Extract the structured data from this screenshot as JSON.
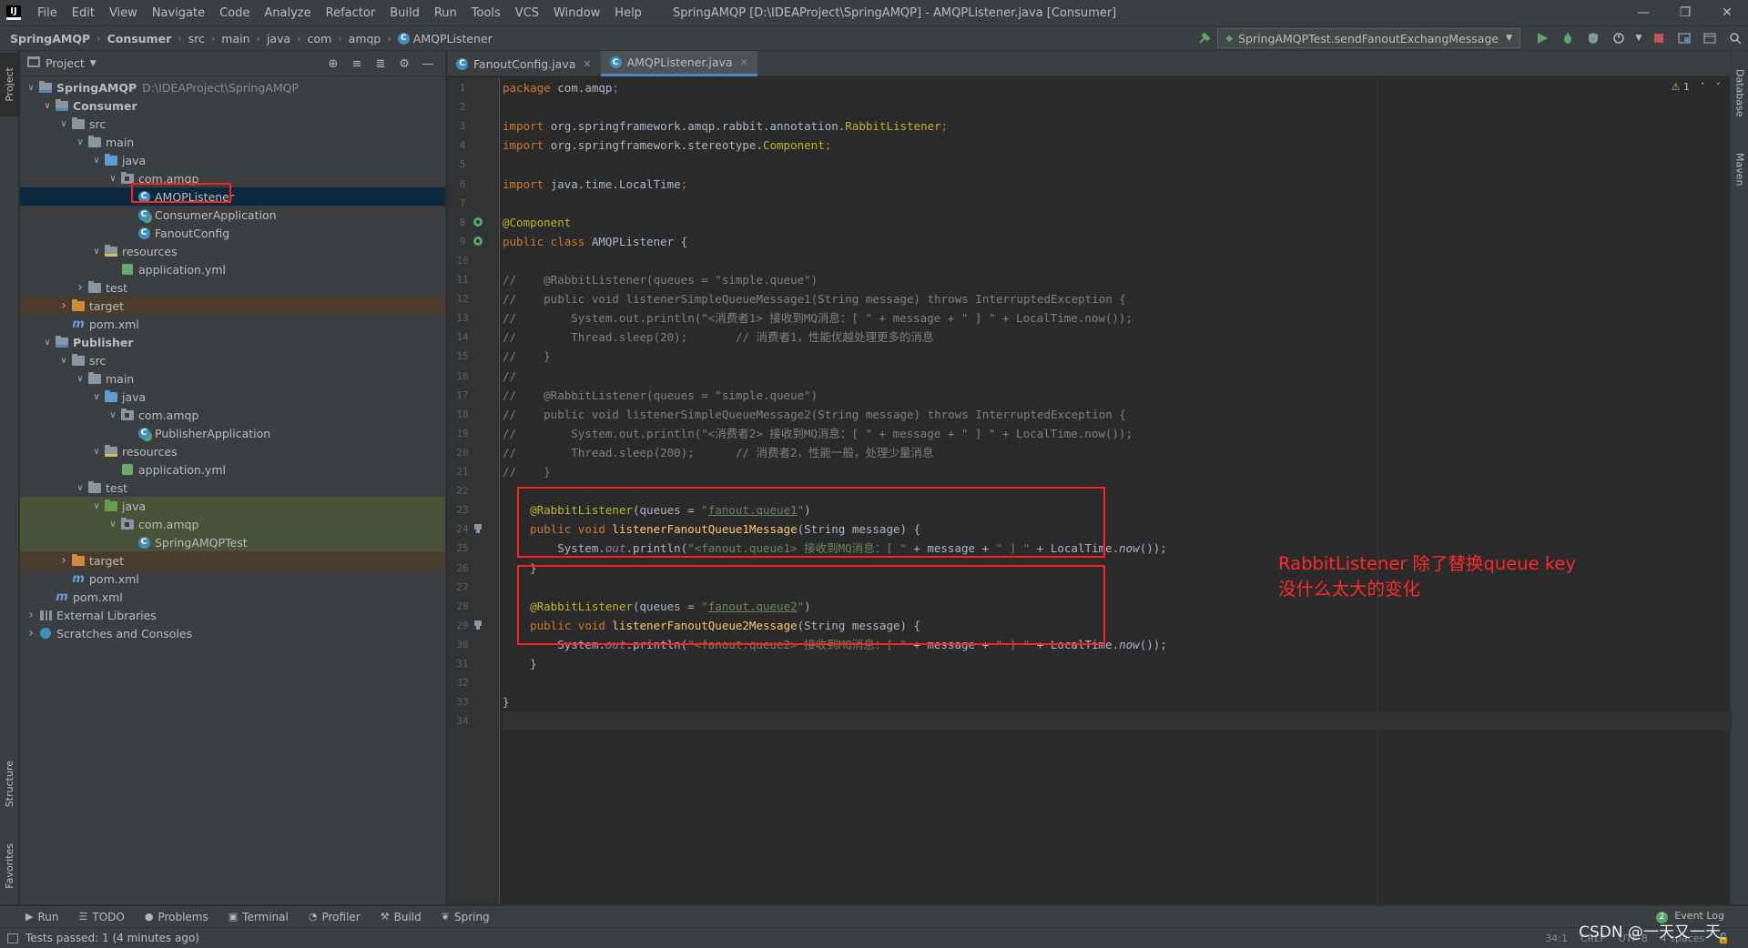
{
  "menubar": {
    "items": [
      "File",
      "Edit",
      "View",
      "Navigate",
      "Code",
      "Analyze",
      "Refactor",
      "Build",
      "Run",
      "Tools",
      "VCS",
      "Window",
      "Help"
    ],
    "title": "SpringAMQP [D:\\IDEAProject\\SpringAMQP] - AMQPListener.java [Consumer]"
  },
  "breadcrumb": [
    "SpringAMQP",
    "Consumer",
    "src",
    "main",
    "java",
    "com",
    "amqp",
    "AMQPListener"
  ],
  "run_config": "SpringAMQPTest.sendFanoutExchangMessage",
  "left_tabs": {
    "project": "Project",
    "structure": "Structure",
    "favorites": "Favorites"
  },
  "right_tabs": {
    "database": "Database",
    "maven": "Maven"
  },
  "project_panel": {
    "title": "Project"
  },
  "tree": [
    {
      "label": "SpringAMQP",
      "path": "D:\\IDEAProject\\SpringAMQP",
      "depth": 0,
      "arrow": "down",
      "icon": "module-folder-icon",
      "bold": true
    },
    {
      "label": "Consumer",
      "depth": 1,
      "arrow": "down",
      "icon": "module-folder-icon",
      "bold": true
    },
    {
      "label": "src",
      "depth": 2,
      "arrow": "down",
      "icon": "folder-icon"
    },
    {
      "label": "main",
      "depth": 3,
      "arrow": "down",
      "icon": "folder-icon"
    },
    {
      "label": "java",
      "depth": 4,
      "arrow": "down",
      "icon": "source-folder-icon"
    },
    {
      "label": "com.amqp",
      "depth": 5,
      "arrow": "down",
      "icon": "package-icon"
    },
    {
      "label": "AMQPListener",
      "depth": 6,
      "arrow": "",
      "icon": "class-icon",
      "state": "selected"
    },
    {
      "label": "ConsumerApplication",
      "depth": 6,
      "arrow": "",
      "icon": "spring-class-icon"
    },
    {
      "label": "FanoutConfig",
      "depth": 6,
      "arrow": "",
      "icon": "class-icon"
    },
    {
      "label": "resources",
      "depth": 4,
      "arrow": "down",
      "icon": "resources-folder-icon"
    },
    {
      "label": "application.yml",
      "depth": 5,
      "arrow": "",
      "icon": "yml-file-icon"
    },
    {
      "label": "test",
      "depth": 3,
      "arrow": "right",
      "icon": "folder-icon"
    },
    {
      "label": "target",
      "depth": 2,
      "arrow": "right",
      "icon": "target-folder-icon",
      "state": "excluded"
    },
    {
      "label": "pom.xml",
      "depth": 2,
      "arrow": "",
      "icon": "maven-icon"
    },
    {
      "label": "Publisher",
      "depth": 1,
      "arrow": "down",
      "icon": "module-folder-icon",
      "bold": true
    },
    {
      "label": "src",
      "depth": 2,
      "arrow": "down",
      "icon": "folder-icon"
    },
    {
      "label": "main",
      "depth": 3,
      "arrow": "down",
      "icon": "folder-icon"
    },
    {
      "label": "java",
      "depth": 4,
      "arrow": "down",
      "icon": "source-folder-icon"
    },
    {
      "label": "com.amqp",
      "depth": 5,
      "arrow": "down",
      "icon": "package-icon"
    },
    {
      "label": "PublisherApplication",
      "depth": 6,
      "arrow": "",
      "icon": "spring-class-icon"
    },
    {
      "label": "resources",
      "depth": 4,
      "arrow": "down",
      "icon": "resources-folder-icon"
    },
    {
      "label": "application.yml",
      "depth": 5,
      "arrow": "",
      "icon": "yml-file-icon"
    },
    {
      "label": "test",
      "depth": 3,
      "arrow": "down",
      "icon": "folder-icon"
    },
    {
      "label": "java",
      "depth": 4,
      "arrow": "down",
      "icon": "test-folder-icon",
      "state": "test"
    },
    {
      "label": "com.amqp",
      "depth": 5,
      "arrow": "down",
      "icon": "package-icon",
      "state": "test"
    },
    {
      "label": "SpringAMQPTest",
      "depth": 6,
      "arrow": "",
      "icon": "class-icon",
      "state": "test"
    },
    {
      "label": "target",
      "depth": 2,
      "arrow": "right",
      "icon": "target-folder-icon",
      "state": "excluded"
    },
    {
      "label": "pom.xml",
      "depth": 2,
      "arrow": "",
      "icon": "maven-icon"
    },
    {
      "label": "pom.xml",
      "depth": 1,
      "arrow": "",
      "icon": "maven-icon"
    },
    {
      "label": "External Libraries",
      "depth": 0,
      "arrow": "right",
      "icon": "libraries-icon"
    },
    {
      "label": "Scratches and Consoles",
      "depth": 0,
      "arrow": "right",
      "icon": "scratches-icon"
    }
  ],
  "editor_tabs": [
    {
      "label": "FanoutConfig.java",
      "active": false
    },
    {
      "label": "AMQPListener.java",
      "active": true
    }
  ],
  "inspection_count": "1",
  "code_lines": [
    [
      [
        "kw",
        "package "
      ],
      [
        "pl",
        "com.amqp"
      ],
      [
        "kw",
        ";"
      ]
    ],
    [],
    [
      [
        "kw",
        "import "
      ],
      [
        "pl",
        "org.springframework.amqp.rabbit.annotation."
      ],
      [
        "an",
        "RabbitListener"
      ],
      [
        "kw",
        ";"
      ]
    ],
    [
      [
        "kw",
        "import "
      ],
      [
        "pl",
        "org.springframework.stereotype."
      ],
      [
        "an",
        "Component"
      ],
      [
        "kw",
        ";"
      ]
    ],
    [],
    [
      [
        "kw",
        "import "
      ],
      [
        "pl",
        "java.time.LocalTime"
      ],
      [
        "kw",
        ";"
      ]
    ],
    [],
    [
      [
        "an",
        "@Component"
      ]
    ],
    [
      [
        "kw",
        "public class "
      ],
      [
        "pl",
        "AMQPListener {"
      ]
    ],
    [],
    [
      [
        "cm",
        "//    @RabbitListener(queues = \"simple.queue\")"
      ]
    ],
    [
      [
        "cm",
        "//    public void listenerSimpleQueueMessage1(String message) throws InterruptedException {"
      ]
    ],
    [
      [
        "cm",
        "//        System.out.println(\"<消费者1> 接收到MQ消息：[ \" + message + \" ] \" + LocalTime.now());"
      ]
    ],
    [
      [
        "cm",
        "//        Thread.sleep(20);       // 消费者1，性能优越处理更多的消息"
      ]
    ],
    [
      [
        "cm",
        "//    }"
      ]
    ],
    [
      [
        "cm",
        "//"
      ]
    ],
    [
      [
        "cm",
        "//    @RabbitListener(queues = \"simple.queue\")"
      ]
    ],
    [
      [
        "cm",
        "//    public void listenerSimpleQueueMessage2(String message) throws InterruptedException {"
      ]
    ],
    [
      [
        "cm",
        "//        System.out.println(\"<消费者2> 接收到MQ消息：[ \" + message + \" ] \" + LocalTime.now());"
      ]
    ],
    [
      [
        "cm",
        "//        Thread.sleep(200);      // 消费者2，性能一般，处理少量消息"
      ]
    ],
    [
      [
        "cm",
        "//    }"
      ]
    ],
    [],
    [
      [
        "pl",
        "    "
      ],
      [
        "an",
        "@RabbitListener"
      ],
      [
        "pl",
        "(queues = "
      ],
      [
        "str",
        "\""
      ],
      [
        "strl",
        "fanout.queue1"
      ],
      [
        "str",
        "\""
      ],
      [
        "pl",
        ")"
      ]
    ],
    [
      [
        "pl",
        "    "
      ],
      [
        "kw",
        "public void "
      ],
      [
        "fn",
        "listenerFanoutQueue1Message"
      ],
      [
        "pl",
        "(String message) {"
      ]
    ],
    [
      [
        "pl",
        "        System."
      ],
      [
        "st",
        "out"
      ],
      [
        "pl",
        ".println("
      ],
      [
        "str",
        "\"<fanout.queue1> 接收到MQ消息：[ \""
      ],
      [
        "pl",
        " + message + "
      ],
      [
        "str",
        "\" ] \""
      ],
      [
        "pl",
        " + LocalTime."
      ],
      [
        "cy",
        "now"
      ],
      [
        "pl",
        "());"
      ]
    ],
    [
      [
        "pl",
        "    }"
      ]
    ],
    [],
    [
      [
        "pl",
        "    "
      ],
      [
        "an",
        "@RabbitListener"
      ],
      [
        "pl",
        "(queues = "
      ],
      [
        "str",
        "\""
      ],
      [
        "strl",
        "fanout.queue2"
      ],
      [
        "str",
        "\""
      ],
      [
        "pl",
        ")"
      ]
    ],
    [
      [
        "pl",
        "    "
      ],
      [
        "kw",
        "public void "
      ],
      [
        "fn",
        "listenerFanoutQueue2Message"
      ],
      [
        "pl",
        "(String message) {"
      ]
    ],
    [
      [
        "pl",
        "        System."
      ],
      [
        "st",
        "out"
      ],
      [
        "pl",
        ".println("
      ],
      [
        "str",
        "\"<fanout.queue2> 接收到MQ消息：[ \""
      ],
      [
        "pl",
        " + message + "
      ],
      [
        "str",
        "\" ] \""
      ],
      [
        "pl",
        " + LocalTime."
      ],
      [
        "cy",
        "now"
      ],
      [
        "pl",
        "());"
      ]
    ],
    [
      [
        "pl",
        "    }"
      ]
    ],
    [],
    [
      [
        "pl",
        "}"
      ]
    ],
    []
  ],
  "annotation": {
    "line1": "RabbitListener 除了替换queue key",
    "line2": "没什么太大的变化"
  },
  "bottom_tools": [
    {
      "label": "Run",
      "icon": "run-icon",
      "glyph": "▶"
    },
    {
      "label": "TODO",
      "icon": "todo-icon",
      "glyph": "☰"
    },
    {
      "label": "Problems",
      "icon": "problems-icon",
      "glyph": "●"
    },
    {
      "label": "Terminal",
      "icon": "terminal-icon",
      "glyph": "▣"
    },
    {
      "label": "Profiler",
      "icon": "profiler-icon",
      "glyph": "◔"
    },
    {
      "label": "Build",
      "icon": "build-icon",
      "glyph": "⚒"
    },
    {
      "label": "Spring",
      "icon": "spring-icon",
      "glyph": "❦"
    }
  ],
  "event_log": {
    "count": "2",
    "label": "Event Log"
  },
  "status": {
    "text": "Tests passed: 1 (4 minutes ago)",
    "position": "34:1",
    "line_sep": "CRLF",
    "encoding": "UTF-8",
    "indent": "4 spaces"
  },
  "watermark": "CSDN @一天又一天",
  "colors": {
    "accent": "#4a88c7",
    "annotation": "#ff2a2a",
    "selected": "#0d293e"
  }
}
